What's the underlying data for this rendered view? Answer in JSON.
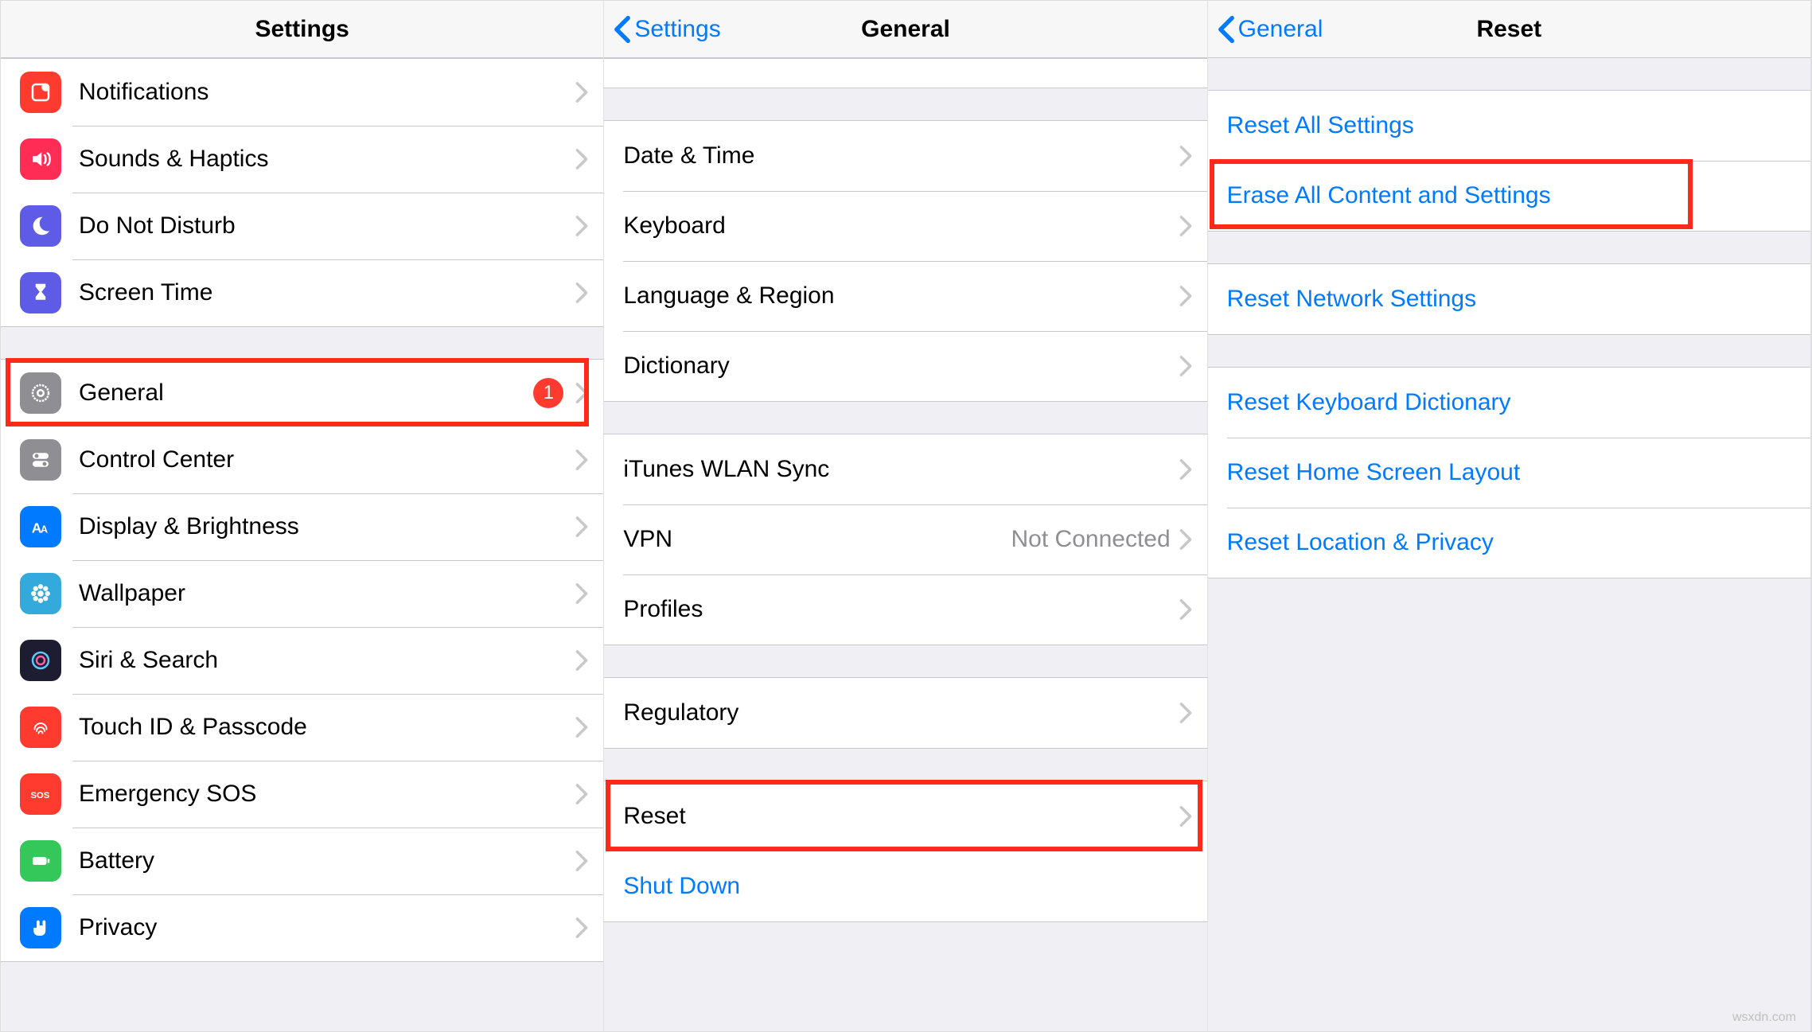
{
  "panel1": {
    "title": "Settings",
    "group1": [
      {
        "label": "Notifications"
      },
      {
        "label": "Sounds & Haptics"
      },
      {
        "label": "Do Not Disturb"
      },
      {
        "label": "Screen Time"
      }
    ],
    "group2": [
      {
        "label": "General",
        "badge": "1"
      },
      {
        "label": "Control Center"
      },
      {
        "label": "Display & Brightness"
      },
      {
        "label": "Wallpaper"
      },
      {
        "label": "Siri & Search"
      },
      {
        "label": "Touch ID & Passcode"
      },
      {
        "label": "Emergency SOS"
      },
      {
        "label": "Battery"
      },
      {
        "label": "Privacy"
      }
    ]
  },
  "panel2": {
    "back": "Settings",
    "title": "General",
    "group1": [
      {
        "label": "Date & Time"
      },
      {
        "label": "Keyboard"
      },
      {
        "label": "Language & Region"
      },
      {
        "label": "Dictionary"
      }
    ],
    "group2": [
      {
        "label": "iTunes WLAN Sync"
      },
      {
        "label": "VPN",
        "detail": "Not Connected"
      },
      {
        "label": "Profiles"
      }
    ],
    "group3": [
      {
        "label": "Regulatory"
      }
    ],
    "group4": [
      {
        "label": "Reset"
      },
      {
        "label": "Shut Down",
        "action": true
      }
    ]
  },
  "panel3": {
    "back": "General",
    "title": "Reset",
    "group1": [
      {
        "label": "Reset All Settings"
      },
      {
        "label": "Erase All Content and Settings"
      }
    ],
    "group2": [
      {
        "label": "Reset Network Settings"
      }
    ],
    "group3": [
      {
        "label": "Reset Keyboard Dictionary"
      },
      {
        "label": "Reset Home Screen Layout"
      },
      {
        "label": "Reset Location & Privacy"
      }
    ]
  },
  "watermark": "wsxdn.com"
}
